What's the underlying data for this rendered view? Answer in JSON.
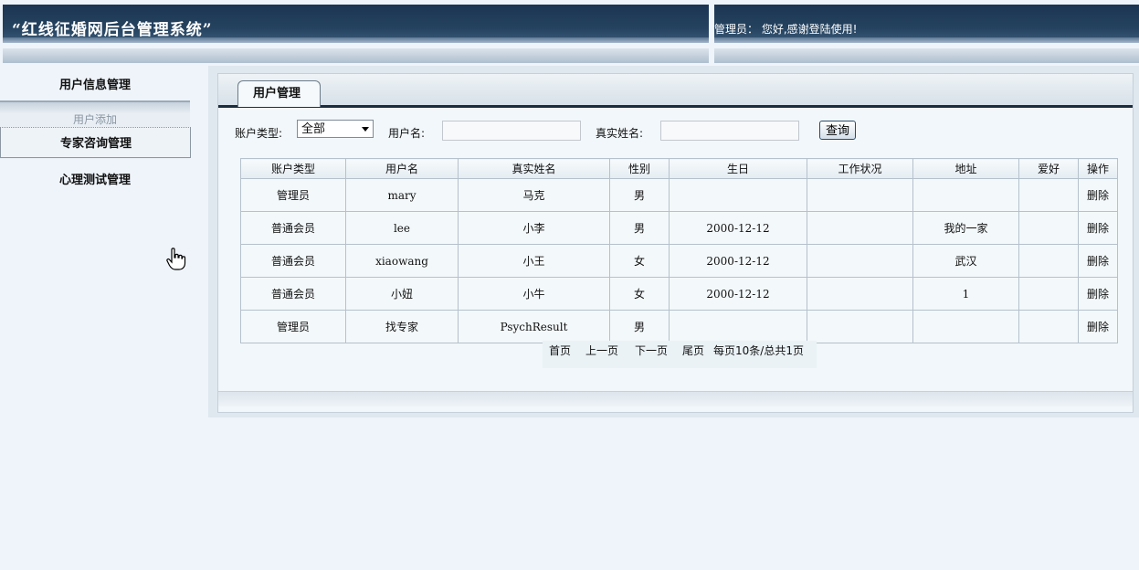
{
  "header": {
    "app_title": "“红线征婚网后台管理系统”",
    "welcome_text": "管理员： 您好,感谢登陆使用!"
  },
  "sidebar": {
    "items": [
      {
        "label": "用户信息管理"
      },
      {
        "label": "用户添加"
      },
      {
        "label": "专家咨询管理"
      },
      {
        "label": "心理测试管理"
      }
    ]
  },
  "main": {
    "tab_label": "用户管理",
    "filter": {
      "account_type_label": "账户类型:",
      "account_type_value": "全部",
      "username_label": "用户名:",
      "username_value": "",
      "realname_label": "真实姓名:",
      "realname_value": "",
      "query_button": "查询"
    },
    "table": {
      "columns": [
        "账户类型",
        "用户名",
        "真实姓名",
        "性别",
        "生日",
        "工作状况",
        "地址",
        "爱好",
        "操作"
      ],
      "rows": [
        [
          "管理员",
          "mary",
          "马克",
          "男",
          "",
          "",
          "",
          "",
          "删除"
        ],
        [
          "普通会员",
          "lee",
          "小李",
          "男",
          "2000-12-12",
          "",
          "我的一家",
          "",
          "删除"
        ],
        [
          "普通会员",
          "xiaowang",
          "小王",
          "女",
          "2000-12-12",
          "",
          "武汉",
          "",
          "删除"
        ],
        [
          "普通会员",
          "小妞",
          "小牛",
          "女",
          "2000-12-12",
          "",
          "1",
          "",
          "删除"
        ],
        [
          "管理员",
          "找专家",
          "PsychResult",
          "男",
          "",
          "",
          "",
          "",
          "删除"
        ]
      ]
    },
    "pager": {
      "first": "首页",
      "prev": "上一页",
      "next": "下一页",
      "last": "尾页",
      "summary": "每页10条/总共1页"
    }
  },
  "icons": {
    "cursor": "hand-pointer-icon"
  }
}
